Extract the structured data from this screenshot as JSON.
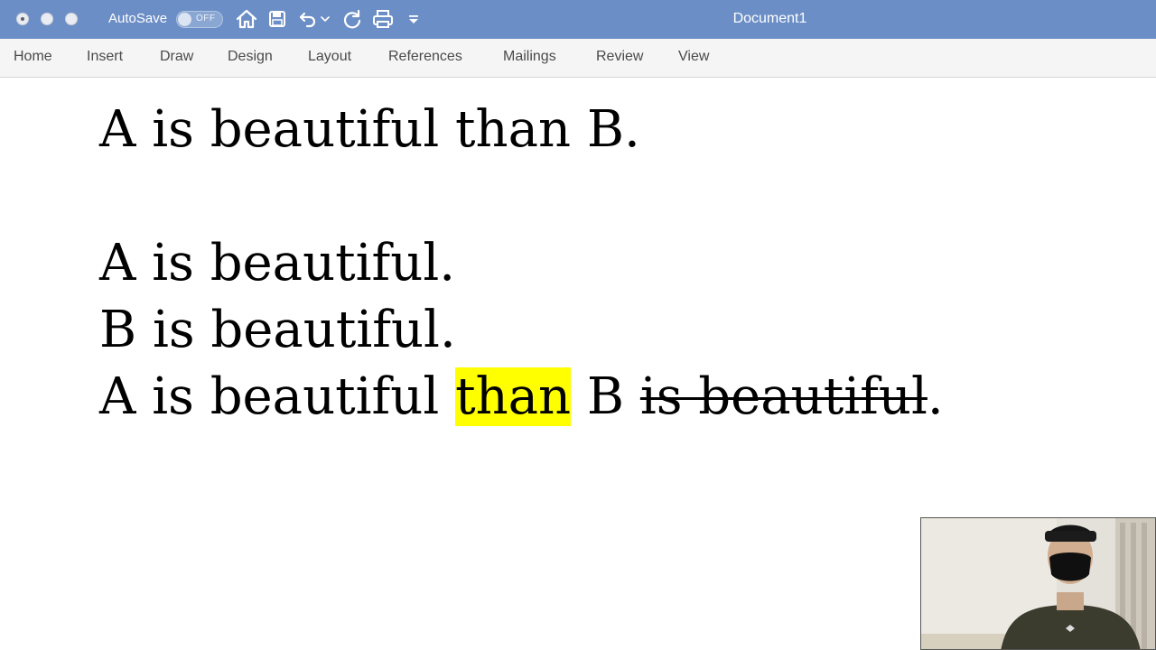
{
  "titlebar": {
    "autosave_label": "AutoSave",
    "autosave_state": "OFF",
    "document_title": "Document1",
    "color": "#6b8ec6"
  },
  "ribbon": {
    "tabs": [
      "Home",
      "Insert",
      "Draw",
      "Design",
      "Layout",
      "References",
      "Mailings",
      "Review",
      "View"
    ]
  },
  "document": {
    "line1": "A is beautiful than B.",
    "line2": "A is beautiful.",
    "line3": "B is beautiful.",
    "line4": {
      "before": "A is beautiful ",
      "highlighted": "than",
      "middle": " B ",
      "struck": "is beautiful",
      "end": "."
    },
    "highlight_color": "#ffff00"
  },
  "icons": [
    "home-icon",
    "save-icon",
    "undo-icon",
    "redo-icon",
    "print-icon",
    "customize-toolbar-icon"
  ]
}
